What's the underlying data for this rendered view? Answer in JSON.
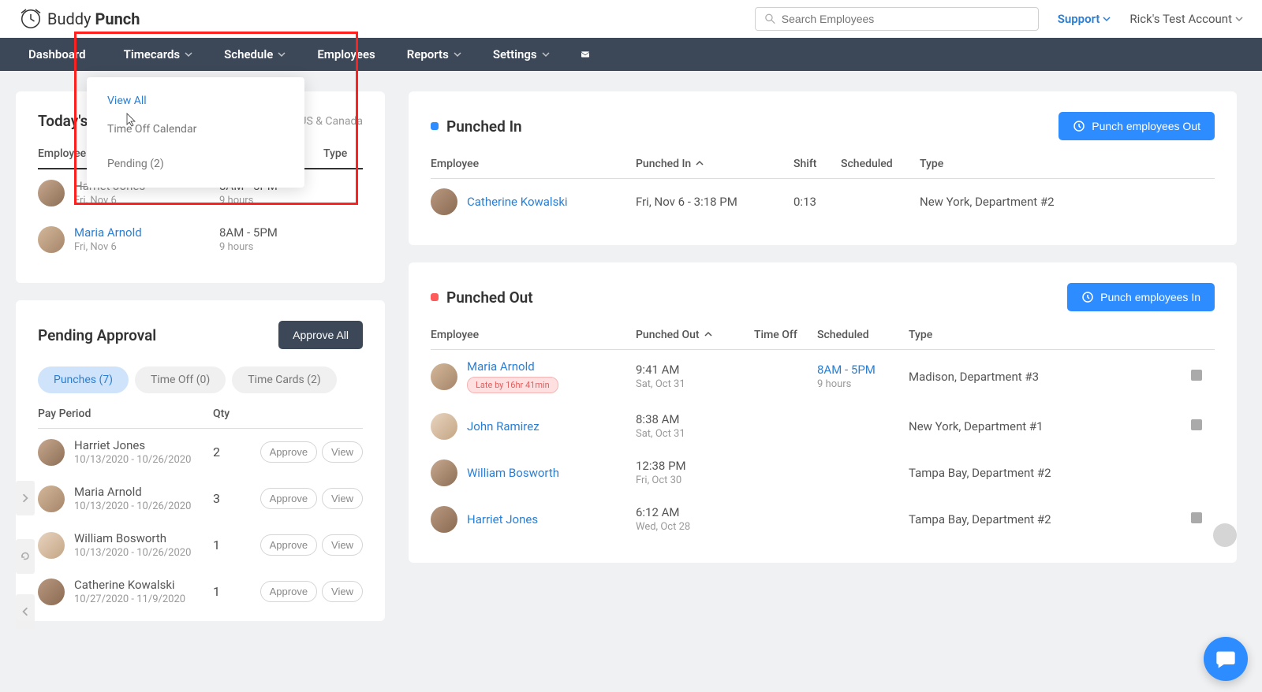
{
  "brand": {
    "name1": "Buddy",
    "name2": "Punch"
  },
  "search": {
    "placeholder": "Search Employees"
  },
  "support": "Support",
  "account": "Rick's Test Account",
  "nav": {
    "dashboard": "Dashboard",
    "timecards": "Timecards",
    "schedule": "Schedule",
    "employees": "Employees",
    "reports": "Reports",
    "settings": "Settings"
  },
  "dropdown": {
    "view_all": "View All",
    "time_off": "Time Off Calendar",
    "pending": "Pending (2)"
  },
  "schedule_card": {
    "title_partial": "Today's S",
    "tz": "US & Canada",
    "h_employee": "Employee",
    "h_type": "Type",
    "rows": [
      {
        "name": "Harriet Jones",
        "date": "Fri, Nov 6",
        "time": "8AM - 5PM",
        "hours": "9 hours",
        "strike": true
      },
      {
        "name": "Maria Arnold",
        "date": "Fri, Nov 6",
        "time": "8AM - 5PM",
        "hours": "9 hours",
        "strike": false
      }
    ]
  },
  "pending_card": {
    "title": "Pending Approval",
    "approve_all": "Approve All",
    "tabs": {
      "punches": "Punches (7)",
      "timeoff": "Time Off (0)",
      "timecards": "Time Cards (2)"
    },
    "h_period": "Pay Period",
    "h_qty": "Qty",
    "btn_approve": "Approve",
    "btn_view": "View",
    "rows": [
      {
        "name": "Harriet Jones",
        "range": "10/13/2020 - 10/26/2020",
        "qty": "2"
      },
      {
        "name": "Maria Arnold",
        "range": "10/13/2020 - 10/26/2020",
        "qty": "3"
      },
      {
        "name": "William Bosworth",
        "range": "10/13/2020 - 10/26/2020",
        "qty": "1"
      },
      {
        "name": "Catherine Kowalski",
        "range": "10/27/2020 - 11/9/2020",
        "qty": "1"
      }
    ]
  },
  "punched_in": {
    "title": "Punched In",
    "btn": "Punch employees Out",
    "h_employee": "Employee",
    "h_time": "Punched In",
    "h_shift": "Shift",
    "h_sched": "Scheduled",
    "h_type": "Type",
    "rows": [
      {
        "name": "Catherine Kowalski",
        "time": "Fri, Nov 6 - 3:18 PM",
        "shift": "0:13",
        "type": "New York, Department #2"
      }
    ]
  },
  "punched_out": {
    "title": "Punched Out",
    "btn": "Punch employees In",
    "h_employee": "Employee",
    "h_time": "Punched Out",
    "h_off": "Time Off",
    "h_sched": "Scheduled",
    "h_type": "Type",
    "rows": [
      {
        "name": "Maria Arnold",
        "late": "Late by 16hr 41min",
        "time": "9:41 AM",
        "date": "Sat, Oct 31",
        "sched": "8AM - 5PM",
        "sched_hours": "9 hours",
        "type": "Madison, Department #3",
        "note": true
      },
      {
        "name": "John Ramirez",
        "time": "8:38 AM",
        "date": "Sat, Oct 31",
        "type": "New York, Department #1",
        "note": true
      },
      {
        "name": "William Bosworth",
        "time": "12:38 PM",
        "date": "Fri, Oct 30",
        "type": "Tampa Bay, Department #2"
      },
      {
        "name": "Harriet Jones",
        "time": "6:12 AM",
        "date": "Wed, Oct 28",
        "type": "Tampa Bay, Department #2",
        "note": true
      }
    ]
  }
}
